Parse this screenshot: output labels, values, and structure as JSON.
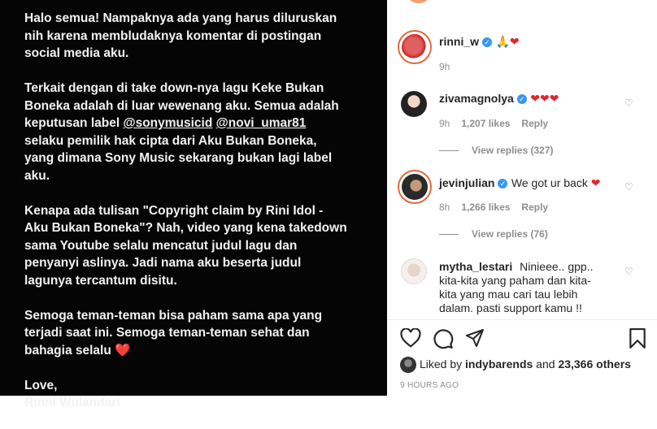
{
  "post": {
    "caption": [
      "Halo semua! Nampaknya ada yang harus diluruskan\nnih karena membludaknya komentar di postingan\nsocial media aku.",
      null,
      "Kenapa ada tulisan \"Copyright claim by Rini Idol -\nAku Bukan Boneka\"? Nah, video yang kena takedown\nsama Youtube selalu mencatut judul lagu dan\npenyanyi aslinya. Jadi nama aku beserta judul\nlagunya tercantum disitu.",
      "Semoga teman-teman bisa paham sama apa yang\nterjadi saat ini. Semoga teman-teman sehat dan\nbahagia selalu",
      "Love,\nRinni Wulandari"
    ],
    "para2_a": "Terkait dengan di take down-nya lagu Keke Bukan\nBoneka adalah di luar wewenang aku. Semua adalah\nkeputusan label ",
    "mention1": "@sonymusicid",
    "mention2": "@novi_umar81",
    "para2_b": "\nselaku pemilik hak cipta dari Aku Bukan Boneka,\nyang dimana Sony Music sekarang bukan lagi label\naku.",
    "heart": "❤️"
  },
  "comments": [
    {
      "user": "rinni_w",
      "text": "🙏❤️",
      "time": "9h"
    },
    {
      "user": "zivamagnolya",
      "text": "❤️❤️❤️",
      "time": "9h",
      "likes": "1,207 likes",
      "reply": "Reply",
      "view_replies": "View replies (327)"
    },
    {
      "user": "jevinjulian",
      "text": "We got ur back ❤️",
      "time": "8h",
      "likes": "1,266 likes",
      "reply": "Reply",
      "view_replies": "View replies (76)"
    },
    {
      "user": "mytha_lestari",
      "text_lines": [
        "Ninieee.. gpp..",
        "kita-kita yang paham dan kita-",
        "kita yang mau cari tau lebih",
        "dalam. pasti support kamu !!"
      ]
    }
  ],
  "likes": {
    "prefix": "Liked by ",
    "user": "indybarends",
    "suffix": " and ",
    "count": "23,366 others"
  },
  "timestamp": "9 HOURS AGO",
  "icons": [
    "heart-icon",
    "comment-icon",
    "share-icon",
    "bookmark-icon",
    "verified-icon",
    "comment-like-icon"
  ]
}
